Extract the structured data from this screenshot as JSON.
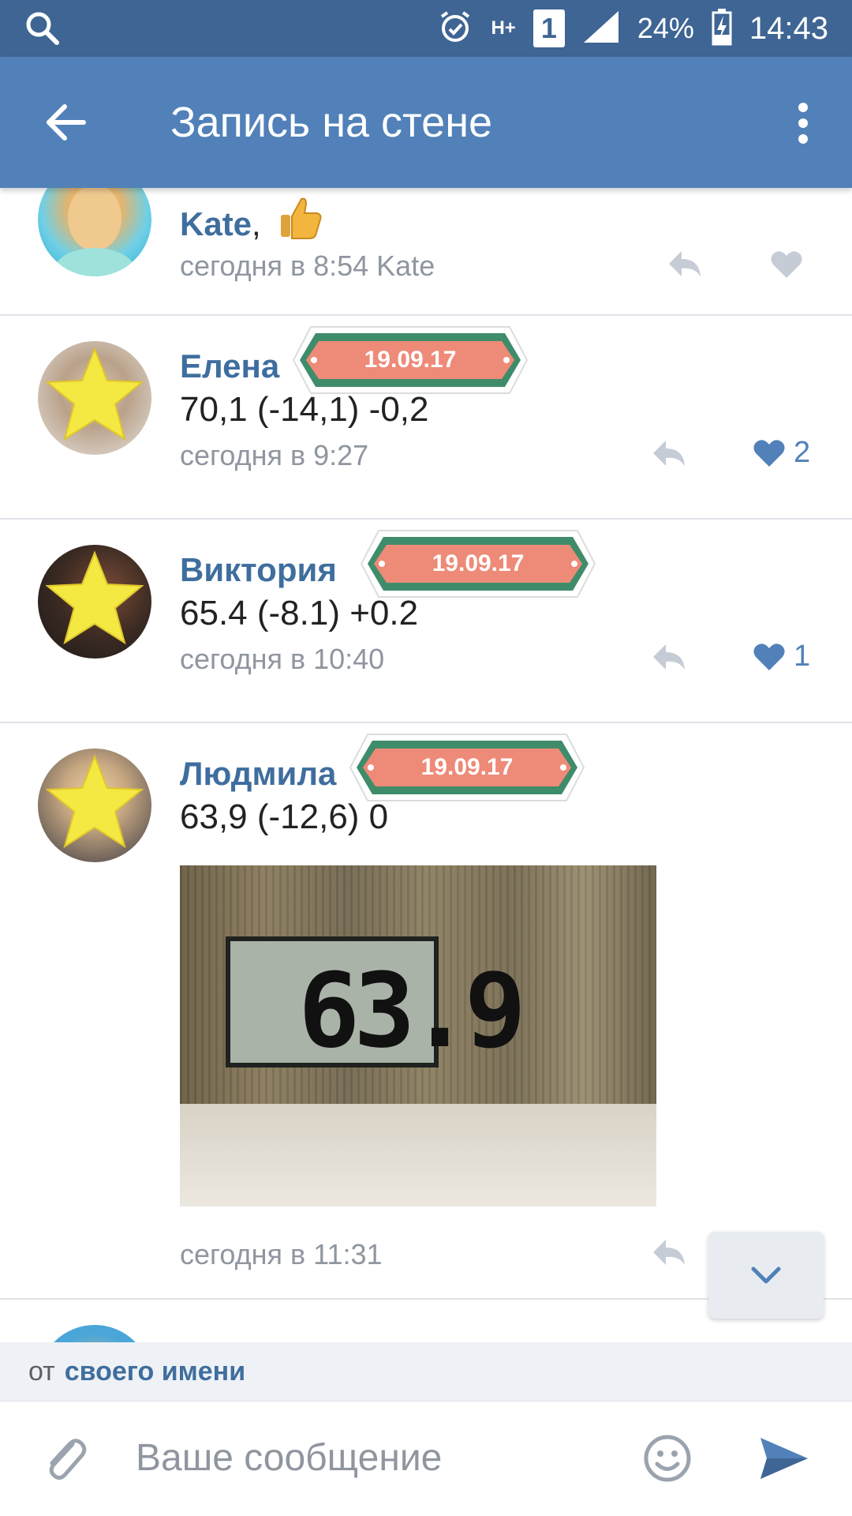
{
  "status_bar": {
    "network": "H+",
    "sim": "1",
    "battery_percent": "24%",
    "time": "14:43"
  },
  "app_bar": {
    "title": "Запись на стене"
  },
  "comments": [
    {
      "name": "Kate",
      "name_suffix": ",",
      "time": "сегодня в 8:54 Kate",
      "likes": ""
    },
    {
      "name": "Елена",
      "text": "70,1 (-14,1) -0,2",
      "time": "сегодня в 9:27",
      "tag": "19.09.17",
      "likes": "2"
    },
    {
      "name": "Виктория",
      "text": "65.4 (-8.1) +0.2",
      "time": "сегодня в 10:40",
      "tag": "19.09.17",
      "likes": "1"
    },
    {
      "name": "Людмила",
      "text": "63,9 (-12,6) 0",
      "time": "сегодня в 11:31",
      "tag": "19.09.17",
      "photo_reading": "63.9"
    }
  ],
  "composer": {
    "from_prefix": "от",
    "from_name": "своего имени",
    "placeholder": "Ваше сообщение"
  },
  "colors": {
    "status_bar": "#3e6594",
    "app_bar": "#5181b8",
    "name_link": "#3f6e9e",
    "tag_fill": "#ee8a78",
    "tag_stripe": "#3f8c6a"
  }
}
